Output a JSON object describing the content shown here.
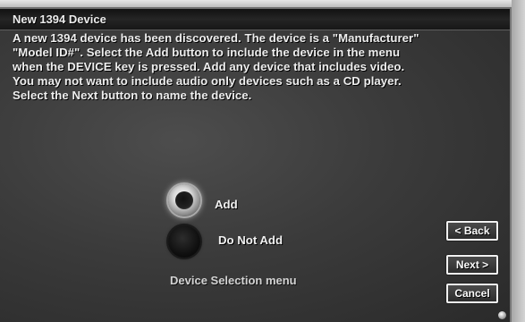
{
  "dialog": {
    "title": "New 1394 Device",
    "message_lines": [
      "A new 1394 device has been discovered. The device is a \"Manufacturer\"",
      "\"Model ID#\".  Select the Add button to include the device in the menu",
      "when the DEVICE key is pressed.  Add any device that includes video.",
      "You may not want to include audio only devices such as a CD player.",
      "Select the Next button to name the device."
    ]
  },
  "options": {
    "add_label": "Add",
    "do_not_add_label": "Do Not Add",
    "selected": "Add",
    "menu_label": "Device Selection menu"
  },
  "buttons": {
    "back": "< Back",
    "next": "Next >",
    "cancel": "Cancel"
  },
  "colors": {
    "dialog_background": "#3b3b3b",
    "title_bar": "#171717",
    "text": "#eeeeee",
    "button_border": "#f1f1f1"
  },
  "icons": {
    "selected_radio": "radio-selected-icon",
    "unselected_radio": "radio-unselected-icon",
    "corner": "corner-dot-icon"
  }
}
